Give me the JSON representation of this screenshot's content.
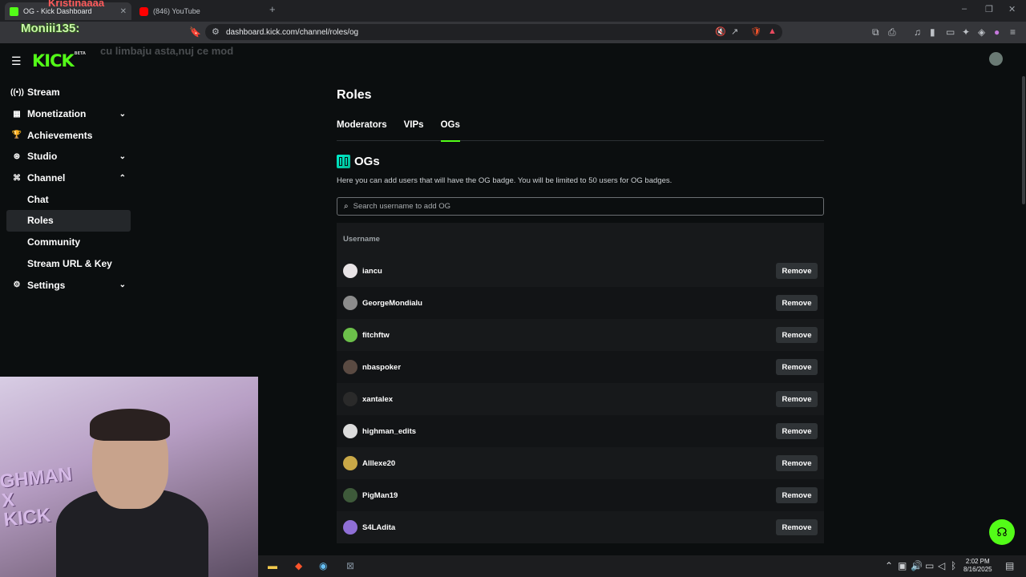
{
  "browser": {
    "tabs": [
      {
        "title": "OG - Kick Dashboard",
        "active": true
      },
      {
        "title": "(846) YouTube",
        "active": false
      }
    ],
    "new_tab": "+",
    "url": "dashboard.kick.com/channel/roles/og",
    "window_controls": [
      "–",
      "❐",
      "✕"
    ]
  },
  "overlay": {
    "name_top": "Kristinaaaa",
    "name": "Moniii135:",
    "message": "cu limbaju asta,nuj ce mod"
  },
  "app": {
    "logo": "KICK",
    "logo_badge": "BETA"
  },
  "sidebar": {
    "items": [
      {
        "label": "Stream",
        "icon": "broadcast-icon",
        "glyph": "((•))",
        "chevron": ""
      },
      {
        "label": "Monetization",
        "icon": "monetization-icon",
        "glyph": "▦",
        "chevron": "⌄"
      },
      {
        "label": "Achievements",
        "icon": "trophy-icon",
        "glyph": "🏆",
        "chevron": ""
      },
      {
        "label": "Studio",
        "icon": "studio-icon",
        "glyph": "⊛",
        "chevron": "⌄"
      },
      {
        "label": "Channel",
        "icon": "channel-icon",
        "glyph": "⌘",
        "chevron": "⌃"
      },
      {
        "label": "Chat",
        "sub": true
      },
      {
        "label": "Roles",
        "sub": true,
        "selected": true
      },
      {
        "label": "Community",
        "sub": true
      },
      {
        "label": "Stream URL & Key",
        "sub": true
      },
      {
        "label": "Settings",
        "icon": "gear-icon",
        "glyph": "⚙",
        "chevron": "⌄"
      }
    ]
  },
  "main": {
    "title": "Roles",
    "tabs": [
      "Moderators",
      "VIPs",
      "OGs"
    ],
    "active_tab": "OGs",
    "section_title": "OGs",
    "description": "Here you can add users that will have the OG badge. You will be limited to 50 users for OG badges.",
    "search_placeholder": "Search username to add OG",
    "column_header": "Username",
    "remove_label": "Remove",
    "users": [
      {
        "name": "iancu",
        "avatar_color": "#e8e4e6"
      },
      {
        "name": "GeorgeMondialu",
        "avatar_color": "#8c8c8c"
      },
      {
        "name": "fitchftw",
        "avatar_color": "#6cc04a"
      },
      {
        "name": "nbaspoker",
        "avatar_color": "#5a4a42"
      },
      {
        "name": "xantalex",
        "avatar_color": "#2a2a2a"
      },
      {
        "name": "highman_edits",
        "avatar_color": "#dcdcdc"
      },
      {
        "name": "Alllexe20",
        "avatar_color": "#c9a847"
      },
      {
        "name": "PigMan19",
        "avatar_color": "#3e5a3a"
      },
      {
        "name": "S4LAdita",
        "avatar_color": "#8f6fd6"
      }
    ]
  },
  "webcam": {
    "text": "GHMAN\nX\nKICK"
  },
  "taskbar": {
    "time": "2:02 PM",
    "date": "8/16/2025"
  },
  "colors": {
    "accent": "#53fc18",
    "background": "#0b0e0f"
  }
}
